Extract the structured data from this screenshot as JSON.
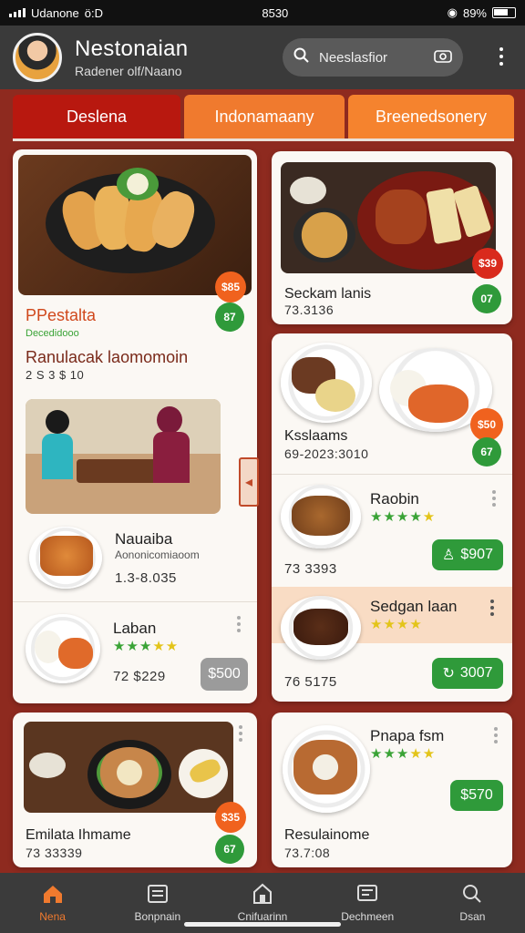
{
  "status_bar": {
    "carrier": "Udanone",
    "signal_text": "ö:D",
    "time": "8530",
    "battery": "89%"
  },
  "header": {
    "app_name": "Nestonaian",
    "subtitle": "Radener olf/Naano"
  },
  "search": {
    "value": "Neeslasfior"
  },
  "tabs": [
    {
      "label": "Deslena"
    },
    {
      "label": "Indonamaany"
    },
    {
      "label": "Breenedsonery"
    }
  ],
  "left_column": {
    "card1": {
      "badge_top": "$85",
      "badge_bottom": "87",
      "tag": "PPestalta",
      "subtag": "Decedidooo",
      "title": "Ranulacak laomomoin",
      "meta": "2 S 3 $ 10"
    },
    "item_nauaiba": {
      "title": "Nauaiba",
      "subtitle": "Aononicomiaoom",
      "meta": "1.3-8.035"
    },
    "item_laban": {
      "title": "Laban",
      "meta": "72 $229",
      "price": "$500"
    },
    "card3": {
      "title": "Emilata Ihmame",
      "meta": "73 33339",
      "badge_top": "$35",
      "badge_bottom": "67"
    }
  },
  "right_column": {
    "card1": {
      "title": "Seckam lanis",
      "meta": "73.3136",
      "badge_top": "$39",
      "badge_bottom": "07"
    },
    "card2": {
      "title": "Ksslaams",
      "meta": "69-2023:3010",
      "badge_top": "$50",
      "badge_bottom": "67"
    },
    "item_raobin": {
      "title": "Raobin",
      "meta": "73 3393",
      "price": "$907"
    },
    "item_sedgan": {
      "title": "Sedgan laan",
      "meta": "76 5175",
      "price": "3007"
    },
    "card3": {
      "title": "Pnapa fsm",
      "meta": "73.7:08",
      "subtitle": "Resulainome",
      "price": "$570"
    }
  },
  "bottom_nav": [
    {
      "label": "Nena",
      "icon": "home-icon"
    },
    {
      "label": "Bonpnain",
      "icon": "menu-list-icon"
    },
    {
      "label": "Cnifuarinn",
      "icon": "store-icon"
    },
    {
      "label": "Dechmeen",
      "icon": "receipt-icon"
    },
    {
      "label": "Dsan",
      "icon": "search-user-icon"
    }
  ],
  "colors": {
    "accent_red": "#b8180f",
    "accent_orange": "#f07a2e",
    "green": "#2f9a3a",
    "header": "#3a3a3a"
  }
}
